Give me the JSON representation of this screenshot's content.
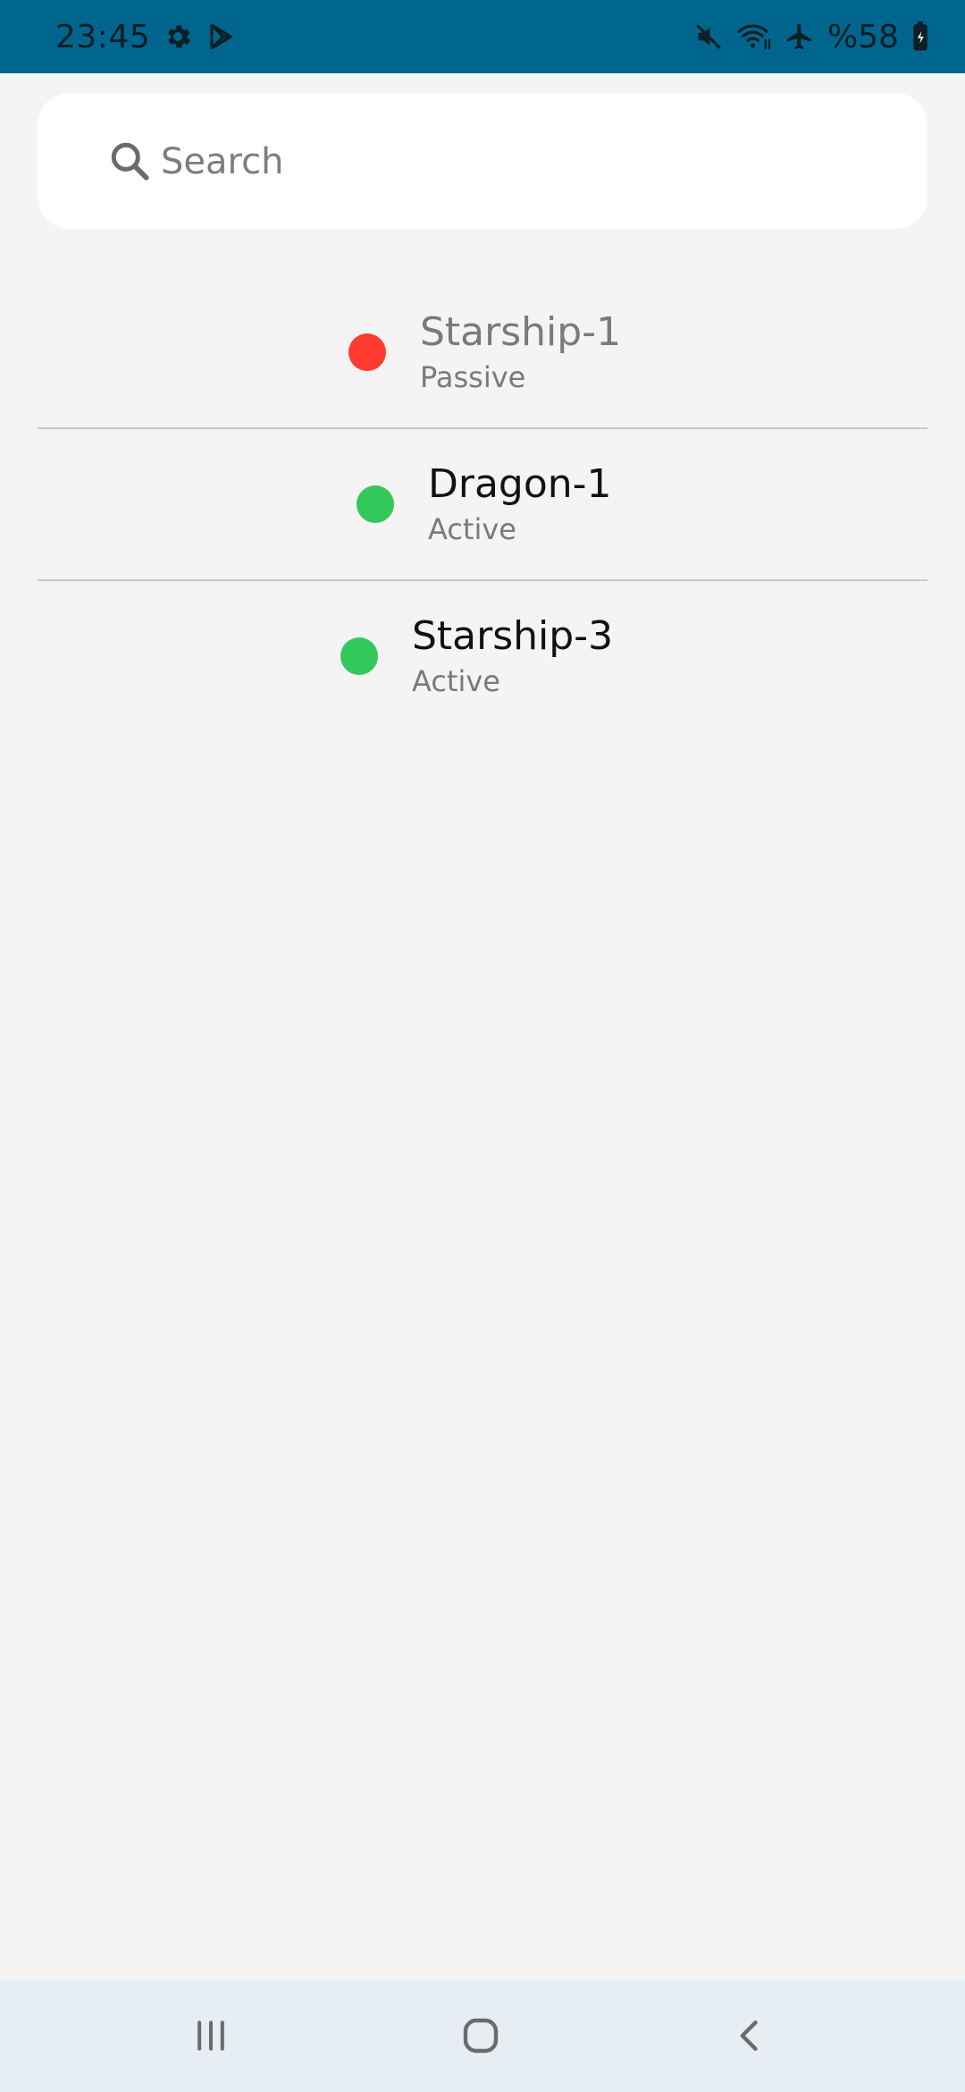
{
  "status_bar": {
    "time": "23:45",
    "battery_text": "%58",
    "bg_color": "#00658c",
    "icons_left": [
      "gear-icon",
      "play-store-icon"
    ],
    "icons_right": [
      "mute-icon",
      "wifi-icon",
      "airplane-icon",
      "battery-icon"
    ]
  },
  "search": {
    "placeholder": "Search",
    "value": ""
  },
  "list": {
    "items": [
      {
        "name": "Starship-1",
        "status": "Passive",
        "dot_color": "#ff3b30"
      },
      {
        "name": "Dragon-1",
        "status": "Active",
        "dot_color": "#34c759"
      },
      {
        "name": "Starship-3",
        "status": "Active",
        "dot_color": "#34c759"
      }
    ]
  },
  "nav_bar": {
    "buttons": [
      "recent-apps-icon",
      "home-icon",
      "back-icon"
    ]
  }
}
